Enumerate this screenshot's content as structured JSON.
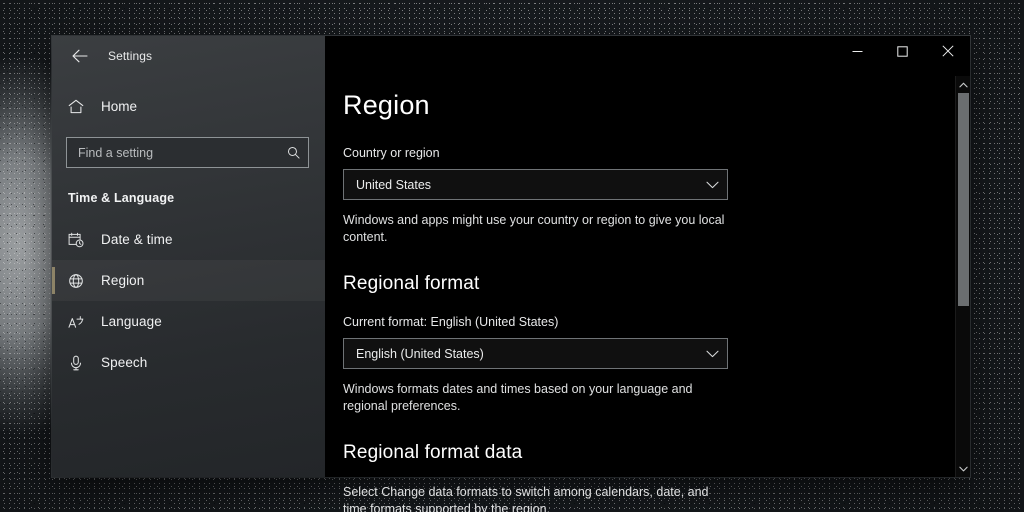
{
  "window": {
    "app_title": "Settings",
    "back_icon": "back-arrow-icon",
    "controls": {
      "minimize_label": "─",
      "maximize_label": "□",
      "close_label": "✕"
    }
  },
  "sidebar": {
    "home_label": "Home",
    "home_icon": "home-icon",
    "search": {
      "placeholder": "Find a setting",
      "value": "",
      "icon": "search-icon"
    },
    "group_title": "Time & Language",
    "items": [
      {
        "label": "Date & time",
        "icon": "calendar-clock-icon",
        "selected": false
      },
      {
        "label": "Region",
        "icon": "globe-icon",
        "selected": true
      },
      {
        "label": "Language",
        "icon": "language-icon",
        "selected": false
      },
      {
        "label": "Speech",
        "icon": "microphone-icon",
        "selected": false
      }
    ]
  },
  "main": {
    "page_title": "Region",
    "country_label": "Country or region",
    "country_value": "United States",
    "country_help": "Windows and apps might use your country or region to give you local content.",
    "regional_format_heading": "Regional format",
    "current_format_label": "Current format: English (United States)",
    "format_value": "English (United States)",
    "format_help": "Windows formats dates and times based on your language and regional preferences.",
    "format_data_heading": "Regional format data",
    "format_data_help": "Select Change data formats to switch among calendars, date, and time formats supported by the region."
  },
  "scrollbar": {
    "up_icon": "chevron-up-icon",
    "down_icon": "chevron-down-icon",
    "thumb_percent": 58
  },
  "colors": {
    "accent": "#8d8367",
    "content_bg": "#000000",
    "sidebar_bg": "#35383b"
  }
}
